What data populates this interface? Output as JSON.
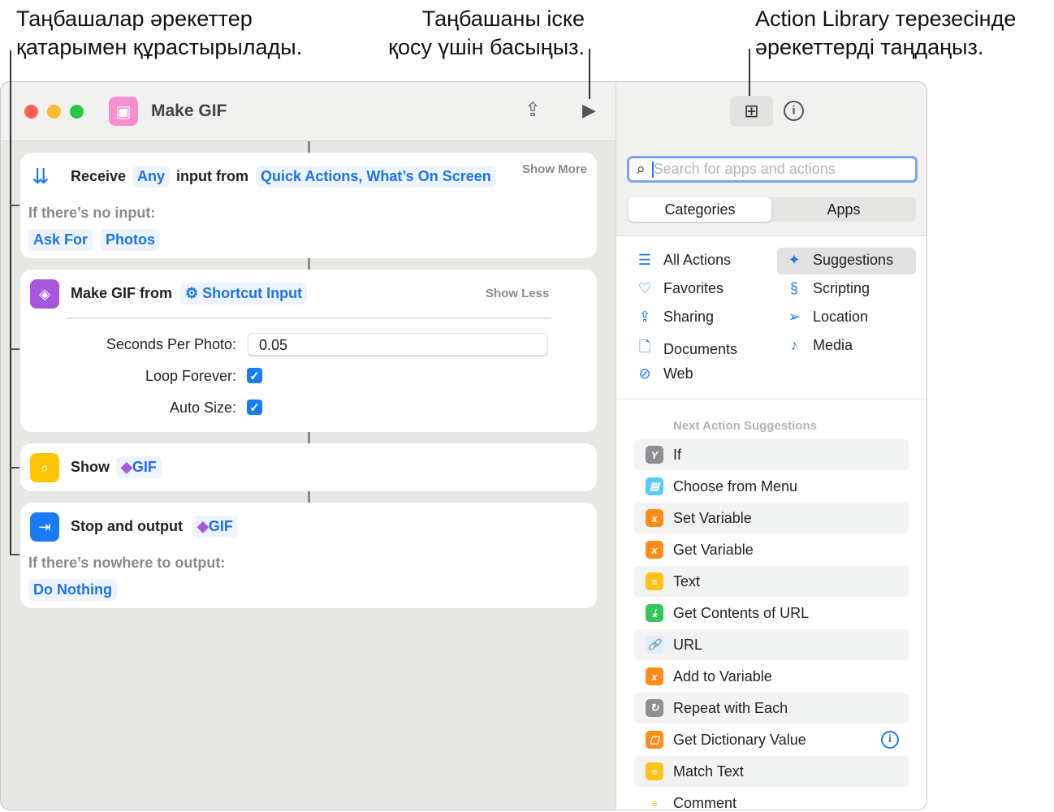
{
  "callouts": {
    "left": [
      "Таңбашалар әрекеттер",
      "қатарымен құрастырылады."
    ],
    "middle": [
      "Таңбашаны іске",
      "қосу үшін басыңыз."
    ],
    "right": [
      "Action Library терезесінде",
      "әрекеттерді таңдаңыз."
    ]
  },
  "window": {
    "title": "Make GIF"
  },
  "actions": {
    "receive": {
      "title": "Receive",
      "type": "Any",
      "mid": "input from",
      "source": "Quick Actions, What’s On Screen",
      "show_more": "Show More",
      "no_input_label": "If there’s no input:",
      "fallback": [
        "Ask For",
        "Photos"
      ]
    },
    "make_gif": {
      "title": "Make GIF from",
      "input": "Shortcut Input",
      "show_less": "Show Less",
      "seconds_label": "Seconds Per Photo:",
      "seconds_value": "0.05",
      "loop_label": "Loop Forever:",
      "loop_checked": true,
      "autosize_label": "Auto Size:",
      "autosize_checked": true
    },
    "show": {
      "title": "Show",
      "var": "GIF"
    },
    "stop": {
      "title": "Stop and output",
      "var": "GIF",
      "nowhere_label": "If there’s nowhere to output:",
      "fallback": "Do Nothing"
    }
  },
  "library": {
    "search_placeholder": "Search for apps and actions",
    "segments": [
      "Categories",
      "Apps"
    ],
    "selected_segment": "Categories",
    "categories_left": [
      {
        "label": "All Actions",
        "icon": "list-icon"
      },
      {
        "label": "Favorites",
        "icon": "heart-icon"
      },
      {
        "label": "Sharing",
        "icon": "share-icon"
      },
      {
        "label": "Documents",
        "icon": "document-icon"
      },
      {
        "label": "Web",
        "icon": "compass-icon"
      }
    ],
    "categories_right": [
      {
        "label": "Suggestions",
        "icon": "sparkles-icon",
        "selected": true
      },
      {
        "label": "Scripting",
        "icon": "scripting-icon"
      },
      {
        "label": "Location",
        "icon": "location-arrow-icon"
      },
      {
        "label": "Media",
        "icon": "music-note-icon"
      }
    ],
    "suggestions_header": "Next Action Suggestions",
    "suggestions": [
      {
        "label": "If",
        "color": "#8e8e93",
        "glyph": "Y"
      },
      {
        "label": "Choose from Menu",
        "color": "#5ac8fa",
        "glyph": "▤"
      },
      {
        "label": "Set Variable",
        "color": "#ff8c1a",
        "glyph": "x"
      },
      {
        "label": "Get Variable",
        "color": "#ff8c1a",
        "glyph": "x"
      },
      {
        "label": "Text",
        "color": "#ffc21a",
        "glyph": "≡"
      },
      {
        "label": "Get Contents of URL",
        "color": "#34c759",
        "glyph": "⤓"
      },
      {
        "label": "URL",
        "color": "#e3ecfb",
        "glyph": "🔗"
      },
      {
        "label": "Add to Variable",
        "color": "#ff8c1a",
        "glyph": "x"
      },
      {
        "label": "Repeat with Each",
        "color": "#8e8e93",
        "glyph": "↻"
      },
      {
        "label": "Get Dictionary Value",
        "color": "#ff8c1a",
        "glyph": "▢",
        "info": true
      },
      {
        "label": "Match Text",
        "color": "#ffc21a",
        "glyph": "≡"
      },
      {
        "label": "Comment",
        "color": "#ffffff",
        "glyph": "≡"
      }
    ]
  }
}
